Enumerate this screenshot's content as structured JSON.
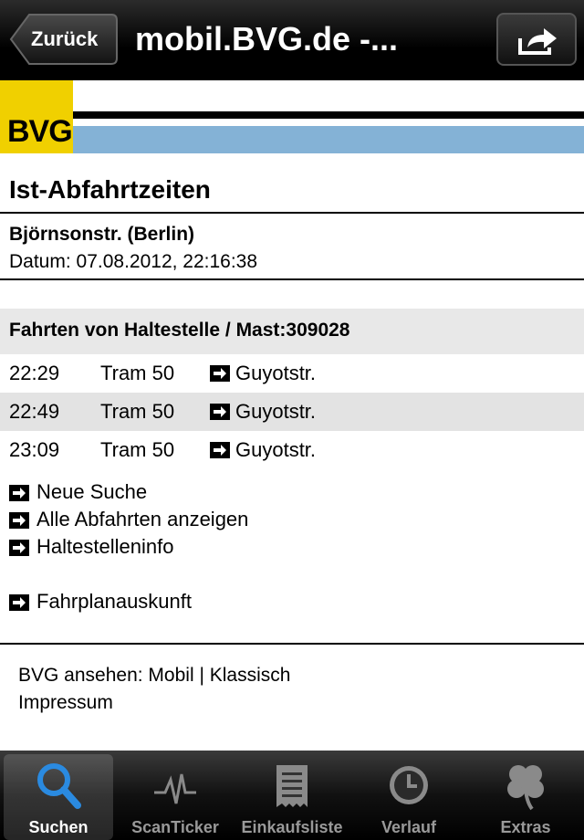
{
  "navbar": {
    "back_label": "Zurück",
    "title": "mobil.BVG.de -..."
  },
  "logo": {
    "text": "BVG"
  },
  "page": {
    "title": "Ist-Abfahrtzeiten",
    "stop_name": "Björnsonstr. (Berlin)",
    "datum": "Datum: 07.08.2012, 22:16:38",
    "section_title": "Fahrten von Haltestelle / Mast:309028"
  },
  "departures": [
    {
      "time": "22:29",
      "line": "Tram 50",
      "destination": "Guyotstr."
    },
    {
      "time": "22:49",
      "line": "Tram 50",
      "destination": "Guyotstr."
    },
    {
      "time": "23:09",
      "line": "Tram 50",
      "destination": "Guyotstr."
    }
  ],
  "links": [
    {
      "label": "Neue Suche"
    },
    {
      "label": "Alle Abfahrten anzeigen"
    },
    {
      "label": "Haltestelleninfo"
    },
    {
      "label": "Fahrplanauskunft"
    }
  ],
  "footer": {
    "line1": "BVG ansehen: Mobil | Klassisch",
    "line2": "Impressum"
  },
  "tabbar": [
    {
      "label": "Suchen",
      "icon": "search-icon",
      "active": true
    },
    {
      "label": "ScanTicker",
      "icon": "pulse-icon",
      "active": false
    },
    {
      "label": "Einkaufsliste",
      "icon": "receipt-icon",
      "active": false
    },
    {
      "label": "Verlauf",
      "icon": "clock-icon",
      "active": false
    },
    {
      "label": "Extras",
      "icon": "clover-icon",
      "active": false
    }
  ],
  "colors": {
    "bvg_yellow": "#f0d000",
    "bvg_blue": "#84b2d6",
    "accent_blue": "#2a8ae0"
  }
}
